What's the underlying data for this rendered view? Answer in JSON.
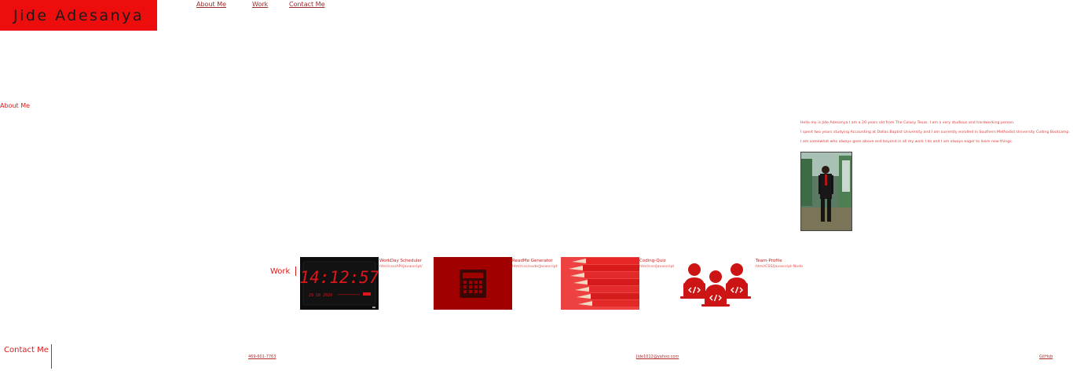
{
  "brand": {
    "name": "Jide Adesanya"
  },
  "nav": {
    "items": [
      "About Me",
      "Work",
      "Contact Me"
    ]
  },
  "about": {
    "heading": "About Me",
    "paragraphs": [
      "Hello my is Jide Adesanya I am a 20 years old from The Colony Texas. I am a very studious and hardworking person.",
      "I spent two years studying Accounting at Dallas Baptist University and I am currently enrolled in Southern Methodist University Coding Bootcamp.",
      "I am somewhat who always goes above and beyond in all my work I do and I am always eager to learn new things."
    ]
  },
  "work": {
    "heading": "Work",
    "projects": [
      {
        "title": "WorkDay Scheduler",
        "tech": "html/css/API/Javascript/",
        "image": "digital-clock-image"
      },
      {
        "title": "ReadMe Generator",
        "tech": "html/css/node/Javascript",
        "image": "calculator-icon"
      },
      {
        "title": "Coding-Quiz",
        "tech": "html/css/Javascript",
        "image": "red-pencils-image"
      },
      {
        "title": "Team-Profile",
        "tech": "html/CSS/Javascript-Node",
        "image": "team-coders-icon"
      }
    ],
    "clock": {
      "time": "14:12:57",
      "date": "29 10 2020"
    }
  },
  "contact": {
    "heading": "Contact Me",
    "links": [
      "469-601-7763",
      "Jide1012@yahoo.com",
      "GitHub"
    ]
  },
  "colors": {
    "accent": "#ee0d0d",
    "text": "#e0161b"
  }
}
